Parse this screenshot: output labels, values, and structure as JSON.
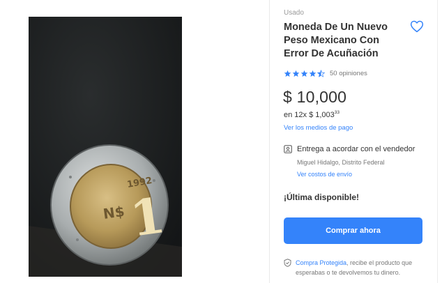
{
  "product": {
    "condition": "Usado",
    "title": "Moneda De Un Nuevo Peso Mexicano Con Error De Acuñación",
    "rating": 4.5,
    "reviews": "50 opiniones",
    "price": "$ 10,000",
    "installments_prefix": "en 12x $ 1,003",
    "installments_cents": "33",
    "payment_link": "Ver los medios de pago",
    "stock": "¡Última disponible!"
  },
  "delivery": {
    "text": "Entrega a acordar con el vendedor",
    "location": "Miguel Hidalgo, Distrito Federal",
    "shipping_link": "Ver costos de envío"
  },
  "actions": {
    "buy_label": "Comprar ahora"
  },
  "protection": {
    "link": "Compra Protegida",
    "text": ", recibe el producto que esperabas o te devolvemos tu dinero."
  },
  "icons": {
    "favorite": "heart-icon",
    "star": "star-icon",
    "delivery": "person-card-icon",
    "protection": "shield-icon"
  },
  "colors": {
    "accent": "#3483fa",
    "star": "#3483fa",
    "text": "#333333",
    "muted": "#999999"
  }
}
